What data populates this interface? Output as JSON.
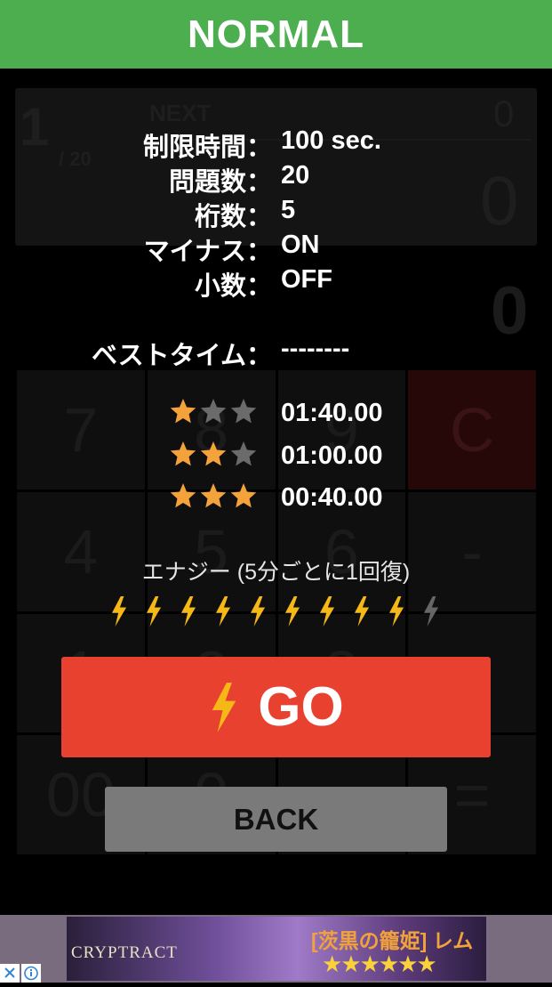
{
  "header": {
    "title": "NORMAL"
  },
  "background_calc": {
    "count": "1",
    "total": "/ 20",
    "next_label": "NEXT",
    "next_value": "0",
    "display_value": "0",
    "answer_value": "0",
    "keys": [
      "7",
      "8",
      "9",
      "C",
      "4",
      "5",
      "6",
      "-",
      "1",
      "2",
      "3",
      "+",
      "00",
      "0",
      ".",
      "="
    ]
  },
  "settings": [
    {
      "label": "制限時間：",
      "value": "100 sec."
    },
    {
      "label": "問題数：",
      "value": "20"
    },
    {
      "label": "桁数：",
      "value": "5"
    },
    {
      "label": "マイナス：",
      "value": "ON"
    },
    {
      "label": "小数：",
      "value": "OFF"
    }
  ],
  "best_time": {
    "label": "ベストタイム：",
    "value": "--------"
  },
  "ranks": [
    {
      "stars_filled": 1,
      "stars_total": 3,
      "time": "01:40.00"
    },
    {
      "stars_filled": 2,
      "stars_total": 3,
      "time": "01:00.00"
    },
    {
      "stars_filled": 3,
      "stars_total": 3,
      "time": "00:40.00"
    }
  ],
  "energy": {
    "label": "エナジー  (5分ごとに1回復)",
    "current": 9,
    "max": 10
  },
  "go_button": {
    "label": "GO"
  },
  "back_button": {
    "label": "BACK"
  },
  "ad": {
    "brand": "CRYPTRACT",
    "title": "[茨黒の籠姫] レム",
    "stars": "★★★★★★"
  },
  "colors": {
    "header": "#4cae4f",
    "go": "#e8412f",
    "back": "#7a7a7a",
    "star": "#f4a23a",
    "star_off": "#6b6b6b",
    "energy": "#f5b816",
    "energy_off": "#666666"
  }
}
